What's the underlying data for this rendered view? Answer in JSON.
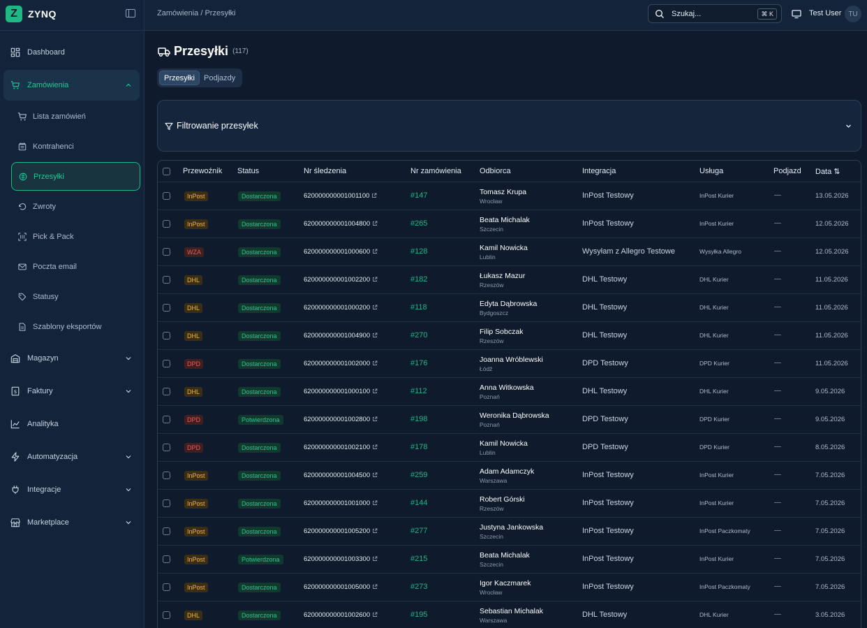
{
  "brand": {
    "logo_letter": "Z",
    "name": "ZYNQ"
  },
  "header": {
    "breadcrumb": "Zamówienia / Przesyłki",
    "search_label": "Szukaj...",
    "search_shortcut": "⌘ K",
    "user_name": "Test User",
    "user_initials": "TU"
  },
  "sidebar": {
    "items": [
      {
        "label": "Dashboard",
        "icon": "dashboard-icon",
        "chevron": false
      },
      {
        "label": "Zamówienia",
        "icon": "cart-icon",
        "chevron": "up",
        "active": true
      },
      {
        "label": "Magazyn",
        "icon": "warehouse-icon",
        "chevron": "down"
      },
      {
        "label": "Faktury",
        "icon": "invoice-icon",
        "chevron": "down"
      },
      {
        "label": "Analityka",
        "icon": "chart-line-icon",
        "chevron": false
      },
      {
        "label": "Automatyzacja",
        "icon": "zap-icon",
        "chevron": "down"
      },
      {
        "label": "Integracje",
        "icon": "plug-icon",
        "chevron": "down"
      },
      {
        "label": "Marketplace",
        "icon": "store-icon",
        "chevron": "down"
      }
    ],
    "sub_items": [
      {
        "label": "Lista zamówień",
        "icon": "cart-icon"
      },
      {
        "label": "Kontrahenci",
        "icon": "building-icon"
      },
      {
        "label": "Przesyłki",
        "icon": "package-icon",
        "selected": true
      },
      {
        "label": "Zwroty",
        "icon": "return-icon"
      },
      {
        "label": "Pick & Pack",
        "icon": "scan-icon"
      },
      {
        "label": "Poczta email",
        "icon": "mail-icon"
      },
      {
        "label": "Statusy",
        "icon": "tag-icon"
      },
      {
        "label": "Szablony eksportów",
        "icon": "file-icon"
      }
    ]
  },
  "page": {
    "title": "Przesyłki",
    "count": "(117)",
    "tabs": [
      {
        "label": "Przesyłki",
        "active": true
      },
      {
        "label": "Podjazdy",
        "active": false
      }
    ],
    "filter_title": "Filtrowanie przesyłek"
  },
  "table": {
    "columns": [
      "Przewoźnik",
      "Status",
      "Nr śledzenia",
      "Nr zamówienia",
      "Odbiorca",
      "Integracja",
      "Usługa",
      "Podjazd",
      "Data ⇅"
    ],
    "carrier_colors": {
      "InPost": {
        "bg": "#3a2e16",
        "fg": "#f5b731"
      },
      "WZA": {
        "bg": "#3f1f20",
        "fg": "#f0595b"
      },
      "DHL": {
        "bg": "#3a2e16",
        "fg": "#f5b731"
      },
      "DPD": {
        "bg": "#3f1f20",
        "fg": "#f0595b"
      }
    },
    "rows": [
      {
        "carrier": "InPost",
        "status": "Dostarczona",
        "tracking": "620000000001001100",
        "order": "#147",
        "name": "Tomasz Krupa",
        "city": "Wrocław",
        "integration": "InPost Testowy",
        "service": "InPost Kurier",
        "slot": "—",
        "date": "13.05.2026"
      },
      {
        "carrier": "InPost",
        "status": "Dostarczona",
        "tracking": "620000000001004800",
        "order": "#265",
        "name": "Beata Michalak",
        "city": "Szczecin",
        "integration": "InPost Testowy",
        "service": "InPost Kurier",
        "slot": "—",
        "date": "12.05.2026"
      },
      {
        "carrier": "WZA",
        "status": "Dostarczona",
        "tracking": "620000000001000600",
        "order": "#128",
        "name": "Kamil Nowicka",
        "city": "Lublin",
        "integration": "Wysyłam z Allegro Testowe",
        "service": "Wysyłka Allegro",
        "slot": "—",
        "date": "12.05.2026"
      },
      {
        "carrier": "DHL",
        "status": "Dostarczona",
        "tracking": "620000000001002200",
        "order": "#182",
        "name": "Łukasz Mazur",
        "city": "Rzeszów",
        "integration": "DHL Testowy",
        "service": "DHL Kurier",
        "slot": "—",
        "date": "11.05.2026"
      },
      {
        "carrier": "DHL",
        "status": "Dostarczona",
        "tracking": "620000000001000200",
        "order": "#118",
        "name": "Edyta Dąbrowska",
        "city": "Bydgoszcz",
        "integration": "DHL Testowy",
        "service": "DHL Kurier",
        "slot": "—",
        "date": "11.05.2026"
      },
      {
        "carrier": "DHL",
        "status": "Dostarczona",
        "tracking": "620000000001004900",
        "order": "#270",
        "name": "Filip Sobczak",
        "city": "Rzeszów",
        "integration": "DHL Testowy",
        "service": "DHL Kurier",
        "slot": "—",
        "date": "11.05.2026"
      },
      {
        "carrier": "DPD",
        "status": "Dostarczona",
        "tracking": "620000000001002000",
        "order": "#176",
        "name": "Joanna Wróblewski",
        "city": "Łódź",
        "integration": "DPD Testowy",
        "service": "DPD Kurier",
        "slot": "—",
        "date": "11.05.2026"
      },
      {
        "carrier": "DHL",
        "status": "Dostarczona",
        "tracking": "620000000001000100",
        "order": "#112",
        "name": "Anna Witkowska",
        "city": "Poznań",
        "integration": "DHL Testowy",
        "service": "DHL Kurier",
        "slot": "—",
        "date": "9.05.2026"
      },
      {
        "carrier": "DPD",
        "status": "Potwierdzona",
        "tracking": "620000000001002800",
        "order": "#198",
        "name": "Weronika Dąbrowska",
        "city": "Poznań",
        "integration": "DPD Testowy",
        "service": "DPD Kurier",
        "slot": "—",
        "date": "9.05.2026"
      },
      {
        "carrier": "DPD",
        "status": "Dostarczona",
        "tracking": "620000000001002100",
        "order": "#178",
        "name": "Kamil Nowicka",
        "city": "Lublin",
        "integration": "DPD Testowy",
        "service": "DPD Kurier",
        "slot": "—",
        "date": "8.05.2026"
      },
      {
        "carrier": "InPost",
        "status": "Dostarczona",
        "tracking": "620000000001004500",
        "order": "#259",
        "name": "Adam Adamczyk",
        "city": "Warszawa",
        "integration": "InPost Testowy",
        "service": "InPost Kurier",
        "slot": "—",
        "date": "7.05.2026"
      },
      {
        "carrier": "InPost",
        "status": "Dostarczona",
        "tracking": "620000000001001000",
        "order": "#144",
        "name": "Robert Górski",
        "city": "Rzeszów",
        "integration": "InPost Testowy",
        "service": "InPost Kurier",
        "slot": "—",
        "date": "7.05.2026"
      },
      {
        "carrier": "InPost",
        "status": "Dostarczona",
        "tracking": "620000000001005200",
        "order": "#277",
        "name": "Justyna Jankowska",
        "city": "Szczecin",
        "integration": "InPost Testowy",
        "service": "InPost Paczkomaty",
        "slot": "—",
        "date": "7.05.2026"
      },
      {
        "carrier": "InPost",
        "status": "Potwierdzona",
        "tracking": "620000000001003300",
        "order": "#215",
        "name": "Beata Michalak",
        "city": "Szczecin",
        "integration": "InPost Testowy",
        "service": "InPost Kurier",
        "slot": "—",
        "date": "7.05.2026"
      },
      {
        "carrier": "InPost",
        "status": "Dostarczona",
        "tracking": "620000000001005000",
        "order": "#273",
        "name": "Igor Kaczmarek",
        "city": "Wrocław",
        "integration": "InPost Testowy",
        "service": "InPost Paczkomaty",
        "slot": "—",
        "date": "7.05.2026"
      },
      {
        "carrier": "DHL",
        "status": "Dostarczona",
        "tracking": "620000000001002600",
        "order": "#195",
        "name": "Sebastian Michalak",
        "city": "Warszawa",
        "integration": "DHL Testowy",
        "service": "DHL Kurier",
        "slot": "—",
        "date": "3.05.2026"
      }
    ]
  }
}
